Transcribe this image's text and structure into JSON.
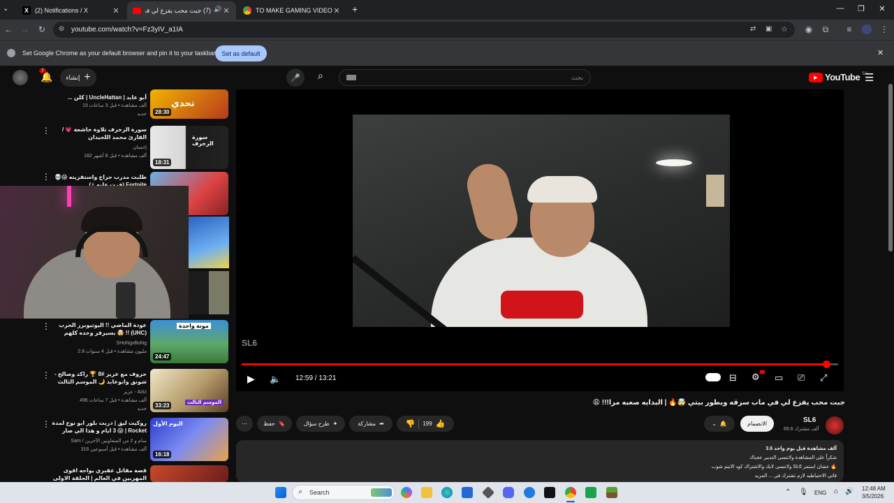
{
  "browser": {
    "tabs": [
      {
        "label": "(2) Notifications / X",
        "favicon": "x-icon"
      },
      {
        "label": "(7) جبت محب يفزع لي في ما",
        "favicon": "youtube-icon",
        "active": true
      },
      {
        "label": "TO MAKE GAMING VIDEO NOT",
        "favicon": "chrome-icon"
      }
    ],
    "url": "youtube.com/watch?v=Fz3yIV_a1IA",
    "infobar": {
      "message": "Set Google Chrome as your default browser and pin it to your taskbar",
      "button": "Set as default"
    }
  },
  "youtube": {
    "logo": "YouTube",
    "logo_region": "SA",
    "create_label": "إنشاء",
    "notifications_count": "7",
    "search_placeholder": "بحث"
  },
  "sidebar": [
    {
      "title": "... كلن | UncleHattan | أبو عابد الشمري",
      "channel": "",
      "meta": "19 ألف مشاهدة • قبل 3 ساعات",
      "badge": "جديد",
      "duration": "28:30",
      "thumb_text": "تحدي"
    },
    {
      "title": "سورة الزخرف تلاوة خاشعة 💗 / القارئ محمد اللحيدان",
      "channel": "إحسان",
      "meta": "182 ألف مشاهدة • قبل 8 أشهر",
      "badge": "",
      "duration": "18:31",
      "thumb_text": "سورة الزخرف"
    },
    {
      "title": "طلبت مدرب حراج واستفزيته 😱💀 (فزت عليه ⚡) Fortnite",
      "channel": "",
      "meta": "",
      "badge": "",
      "duration": "",
      "thumb_text": ""
    },
    {
      "title": "عودة الماضي !! اليوتيوبرز الحرب بسيرفر وحده كلهم 🤯 !! (UHC) مانيكرافت ...",
      "channel": "SHoNgxBoNg",
      "meta": "2.8 مليون مشاهدة • قبل 4 سنوات",
      "badge": "",
      "duration": "24:47",
      "thumb_text": "موتة واحدة"
    },
    {
      "title": "حروف مع عزيز #8 🏆 راكد وصالح - شونق وابوعابد 🌙 الموسم الثالث",
      "channel": "عزيز - Aziz",
      "meta": "496 ألف مشاهدة • قبل 7 ساعات",
      "badge": "جديد",
      "duration": "33:23",
      "thumb_text": "الموسم الثالث"
    },
    {
      "title": "روكيت ليق | دربت بلور ابو نوح لمدة 3 ايام و هذا الي صار 😱 | Rocket League",
      "channel": "Sam / سام و 2 من المتعاونين الآخرين",
      "meta": "316 ألف مشاهدة • قبل أسبوعين",
      "badge": "",
      "duration": "16:18",
      "thumb_text": "اليوم الأول"
    },
    {
      "title": "قصة مقاتل عقبري يواجه اقوى المهربين في العالم | الحلقة الاولى",
      "channel": "",
      "meta": "",
      "badge": "",
      "duration": "",
      "thumb_text": ""
    }
  ],
  "player": {
    "watermark": "SL6",
    "time": "12:59 / 13:21",
    "progress": 0.98
  },
  "video": {
    "title": "جبت محب يفزع لي في ماب سرقه ويطور بيتي 🤯🔥 | البدايه صعبه مرا!!! 😩",
    "channel": "SL6",
    "subscribers": "69.6 ألف مشترك",
    "join_label": "الانضمام",
    "likes": "199",
    "share_label": "مشاركة",
    "ask_label": "طرح سؤال",
    "save_label": "حفظ",
    "desc_lines": [
      "3.6 ألف مشاهدة  قبل يوم واحد",
      "شكراً على المشاهدة ولاتنسى التدبير عجباك",
      "ولاتنسى لايك والاشتراك كود الايتم شوب SL6 عشان استمر 🔥",
      "فاتي الاحتياطيه لازم تشترك في ... المزيد"
    ]
  },
  "taskbar": {
    "search": "Search",
    "lang": "ENG",
    "time": "12:48 AM",
    "date": "3/5/2026"
  },
  "colors": {
    "youtube_red": "#ff0000",
    "chrome_bg": "#202124",
    "yt_bg": "#0f0f0f",
    "accent_blue": "#a8c7fa"
  }
}
